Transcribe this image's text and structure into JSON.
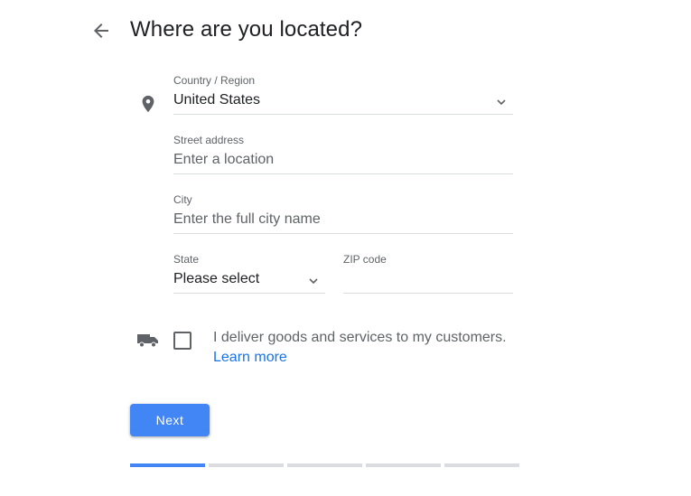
{
  "header": {
    "title": "Where are you located?"
  },
  "form": {
    "country": {
      "label": "Country / Region",
      "value": "United States"
    },
    "street": {
      "label": "Street address",
      "placeholder": "Enter a location"
    },
    "city": {
      "label": "City",
      "placeholder": "Enter the full city name"
    },
    "state": {
      "label": "State",
      "value": "Please select"
    },
    "zip": {
      "label": "ZIP code",
      "value": ""
    }
  },
  "delivery": {
    "checked": false,
    "text": "I deliver goods and services to my customers.",
    "link_label": "Learn more"
  },
  "actions": {
    "next_label": "Next"
  },
  "progress": {
    "total_steps": 5,
    "current_step": 1
  },
  "icons": {
    "back": "arrow-back-icon",
    "location": "location-pin-icon",
    "dropdown": "chevron-down-icon",
    "delivery": "truck-icon"
  },
  "colors": {
    "primary": "#4285f4",
    "link": "#1a73e8",
    "text": "#202124",
    "secondary_text": "#5f6368",
    "divider": "#dadce0"
  }
}
